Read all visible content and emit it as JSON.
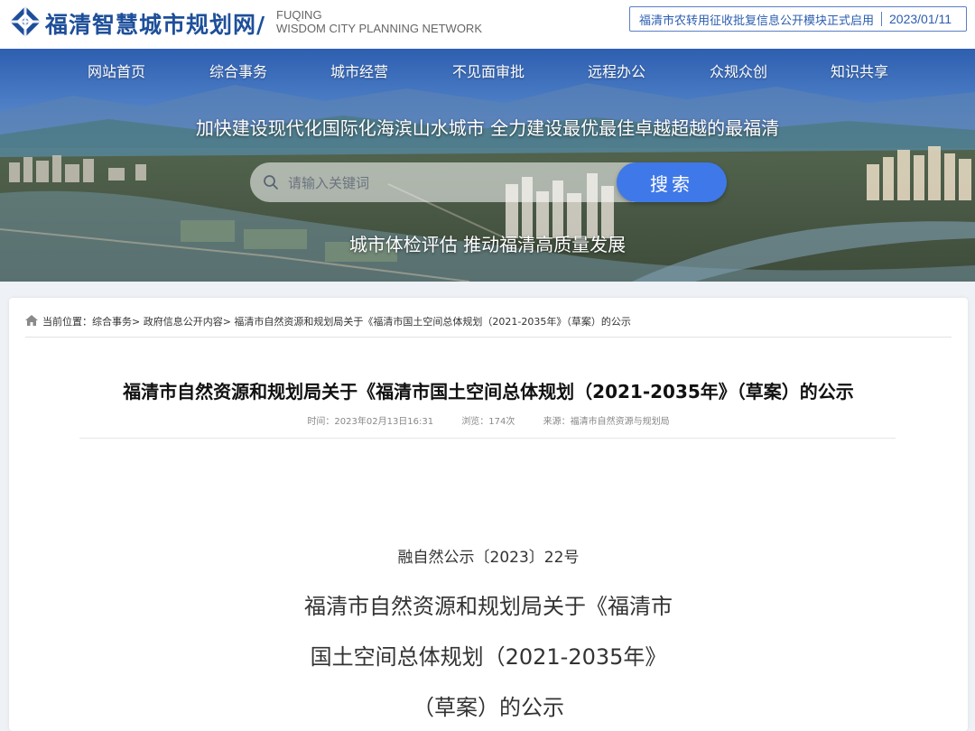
{
  "header": {
    "site_title": "福清智慧城市规划网/",
    "site_title_en_line1": "FUQING",
    "site_title_en_line2": "WISDOM CITY PLANNING NETWORK",
    "notice_text": "福清市农转用征收批复信息公开模块正式启用",
    "notice_date": "2023/01/11"
  },
  "nav": {
    "items": [
      "网站首页",
      "综合事务",
      "城市经营",
      "不见面审批",
      "远程办公",
      "众规众创",
      "知识共享"
    ]
  },
  "banner": {
    "slogan_top": "加快建设现代化国际化海滨山水城市 全力建设最优最佳卓越超越的最福清",
    "slogan_bottom": "城市体检评估  推动福清高质量发展",
    "search_placeholder": "请输入关键词",
    "search_button": "搜索"
  },
  "breadcrumb": {
    "text": "当前位置：综合事务> 政府信息公开内容> 福清市自然资源和规划局关于《福清市国土空间总体规划（2021-2035年》（草案）的公示"
  },
  "article": {
    "title": "福清市自然资源和规划局关于《福清市国土空间总体规划（2021-2035年》（草案）的公示",
    "time": "时间：2023年02月13日16:31",
    "views": "浏览：174次",
    "source": "来源：福清市自然资源与规划局",
    "doc_number": "融自然公示〔2023〕22号",
    "body_title_lines": [
      "福清市自然资源和规划局关于《福清市",
      "国土空间总体规划（2021-2035年》",
      "（草案）的公示"
    ]
  },
  "colors": {
    "brand_blue": "#1e4f9a",
    "notice_blue": "#2a5db0",
    "search_button": "#3f78e8",
    "page_bg": "#eef1f5"
  }
}
